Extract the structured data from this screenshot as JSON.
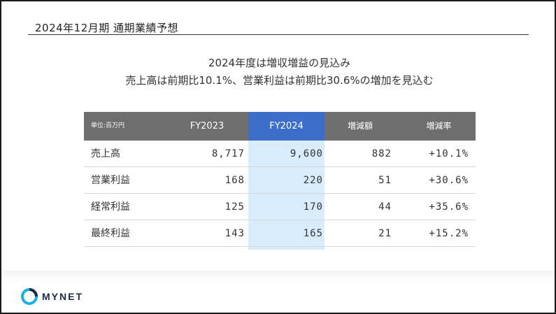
{
  "slide": {
    "title": "2024年12月期 通期業績予想",
    "headline_line1": "2024年度は増収増益の見込み",
    "headline_line2": "売上高は前期比10.1%、営業利益は前期比30.6%の増加を見込む"
  },
  "table": {
    "unit": "単位:百万円",
    "columns": [
      "FY2023",
      "FY2024",
      "増減額",
      "増減率"
    ],
    "rows": [
      {
        "label": "売上高",
        "fy2023": "8,717",
        "fy2024": "9,600",
        "diff": "882",
        "rate": "+10.1%"
      },
      {
        "label": "営業利益",
        "fy2023": "168",
        "fy2024": "220",
        "diff": "51",
        "rate": "+30.6%"
      },
      {
        "label": "経常利益",
        "fy2023": "125",
        "fy2024": "170",
        "diff": "44",
        "rate": "+35.6%"
      },
      {
        "label": "最終利益",
        "fy2023": "143",
        "fy2024": "165",
        "diff": "21",
        "rate": "+15.2%"
      }
    ]
  },
  "brand": {
    "logo_text": "MYNET",
    "logo_icon": "mynet-logo-icon",
    "colors": {
      "header_gray": "#6e6e6e",
      "header_blue": "#3d6ec9",
      "highlight": "#d9ecfb",
      "logo_cyan": "#1ab0e6",
      "logo_navy": "#1c2b4a"
    }
  }
}
